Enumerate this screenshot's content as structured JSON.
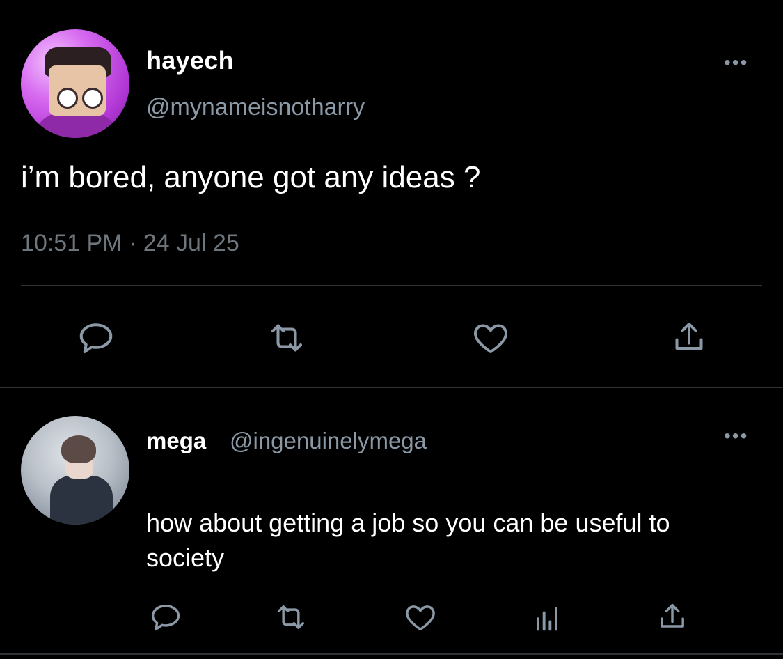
{
  "main_tweet": {
    "display_name": "hayech",
    "handle": "@mynameisnotharry",
    "text": "i’m bored, anyone got any ideas ?",
    "timestamp": "10:51 PM · 24 Jul 25",
    "more_label": "•••",
    "icons": [
      "reply-icon",
      "retweet-icon",
      "like-icon",
      "share-icon"
    ]
  },
  "reply": {
    "display_name": "mega",
    "handle": "@ingenuinelymega",
    "text": "how about getting a job so you can be useful to society",
    "more_label": "•••",
    "icons": [
      "reply-icon",
      "retweet-icon",
      "like-icon",
      "analytics-icon",
      "share-icon"
    ]
  },
  "colors": {
    "background": "#000000",
    "text": "#ffffff",
    "muted": "#8b98a5",
    "divider": "#2f3336"
  }
}
